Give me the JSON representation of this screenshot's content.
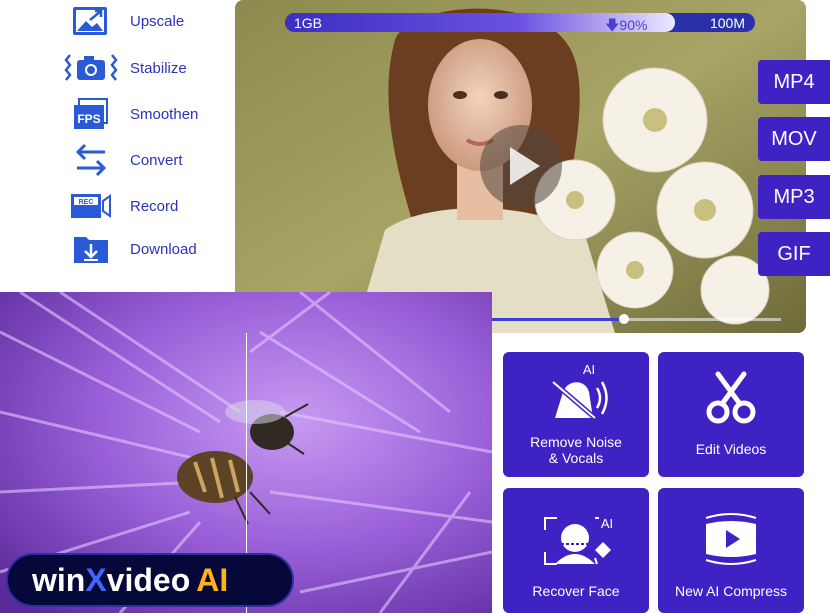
{
  "features": [
    {
      "label": "Upscale",
      "icon": "upscale-icon"
    },
    {
      "label": "Stabilize",
      "icon": "stabilize-icon"
    },
    {
      "label": "Smoothen",
      "icon": "fps-icon"
    },
    {
      "label": "Convert",
      "icon": "convert-icon"
    },
    {
      "label": "Record",
      "icon": "record-icon"
    },
    {
      "label": "Download",
      "icon": "download-icon"
    }
  ],
  "icon_text": {
    "fps": "FPS",
    "rec": "REC",
    "ai": "AI"
  },
  "player": {
    "size_from": "1GB",
    "size_to": "100M",
    "reduction_label": "90%",
    "reduction_fraction": 0.83,
    "playback_progress": 0.7
  },
  "formats": [
    "MP4",
    "MOV",
    "MP3",
    "GIF"
  ],
  "cards": [
    {
      "label_line1": "Remove Noise",
      "label_line2": "& Vocals",
      "icon": "remove-noise-icon"
    },
    {
      "label_line1": "Edit Videos",
      "label_line2": "",
      "icon": "scissors-icon"
    },
    {
      "label_line1": "Recover Face",
      "label_line2": "",
      "icon": "recover-face-icon"
    },
    {
      "label_line1": "New AI Compress",
      "label_line2": "",
      "icon": "compress-icon"
    }
  ],
  "logo": {
    "part1": "win",
    "part2": "X",
    "part3": "video",
    "part4": "AI"
  },
  "colors": {
    "accent": "#3f22c4",
    "link": "#2b34b8",
    "logo_bg": "#07083a",
    "x_color": "#3d67ff",
    "ai_color": "#ffb21a"
  }
}
